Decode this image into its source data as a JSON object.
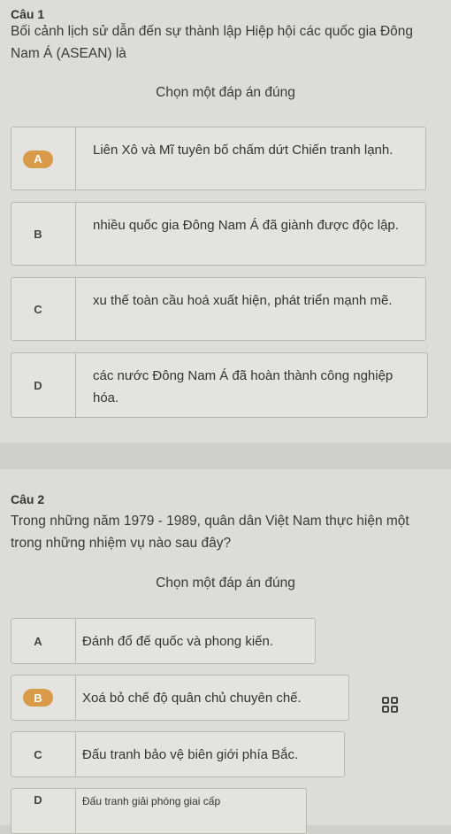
{
  "q1": {
    "title": "Câu 1",
    "text": "Bối cảnh lịch sử dẫn đến sự thành lập Hiệp hội các quốc gia Đông Nam Á (ASEAN) là",
    "hint": "Chọn một đáp án đúng",
    "options": [
      {
        "letter": "A",
        "text": "Liên Xô và Mĩ tuyên bố chấm dứt Chiến tranh lạnh."
      },
      {
        "letter": "B",
        "text": "nhiều quốc gia Đông Nam Á đã giành được độc lập."
      },
      {
        "letter": "C",
        "text": "xu thế toàn cầu hoá xuất hiện, phát triển mạnh mẽ."
      },
      {
        "letter": "D",
        "text": "các nước Đông Nam Á đã hoàn thành công nghiệp hóa."
      }
    ]
  },
  "q2": {
    "title": "Câu 2",
    "text": "Trong những năm 1979 - 1989, quân dân Việt Nam thực hiện một trong những nhiệm vụ nào sau đây?",
    "hint": "Chọn một đáp án đúng",
    "options": [
      {
        "letter": "A",
        "text": "Đánh đổ đế quốc và phong kiến."
      },
      {
        "letter": "B",
        "text": "Xoá bỏ chế độ quân chủ chuyên chế."
      },
      {
        "letter": "C",
        "text": "Đấu tranh bảo vệ biên giới phía Bắc."
      },
      {
        "letter": "D",
        "text": "Đấu tranh giải phóng giai cấp"
      }
    ]
  },
  "colors": {
    "selected_badge": "#d99a4a",
    "card_bg": "#dcdcd8"
  },
  "icons": {
    "expand": "grid-expand-icon"
  }
}
